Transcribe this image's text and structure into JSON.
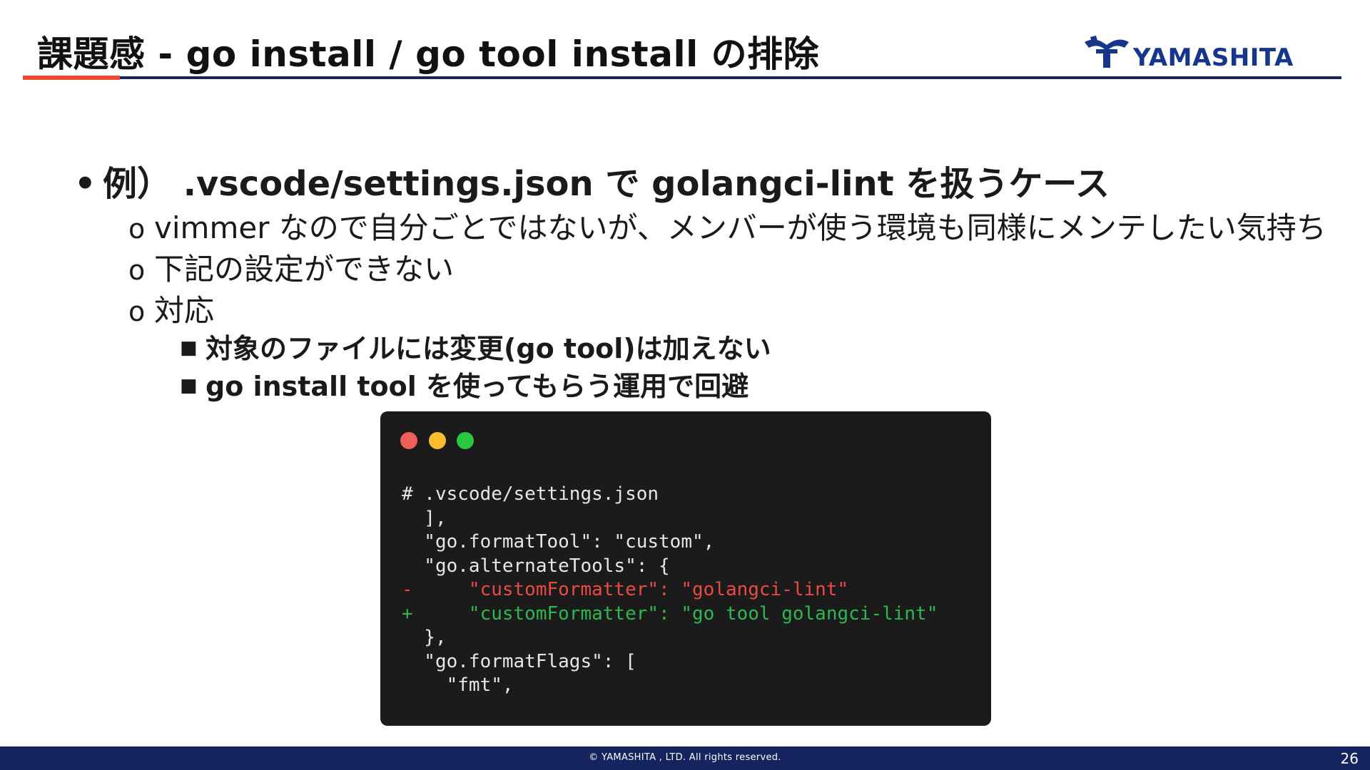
{
  "slide": {
    "title": "課題感 - go install / go tool install の排除",
    "logo_text": "YAMASHITA",
    "logo_icon": "yamashita-mark-icon",
    "colors": {
      "navy": "#15235e",
      "accent_red": "#ee4b30",
      "logo_blue": "#15368a"
    }
  },
  "bullets": {
    "l1": {
      "marker": "•",
      "text": "例） .vscode/settings.json で golangci-lint を扱うケース"
    },
    "l2": [
      {
        "marker": "o",
        "text": "vimmer なので自分ごとではないが、メンバーが使う環境も同様にメンテしたい気持ち"
      },
      {
        "marker": "o",
        "text": "下記の設定ができない"
      },
      {
        "marker": "o",
        "text": "対応"
      }
    ],
    "l3": [
      {
        "marker": "■",
        "text": "対象のファイルには変更(go tool)は加えない"
      },
      {
        "marker": "■",
        "text": "go install tool を使ってもらう運用で回避"
      }
    ]
  },
  "code": {
    "lines": [
      "# .vscode/settings.json",
      "  ],",
      "  \"go.formatTool\": \"custom\",",
      "  \"go.alternateTools\": {",
      "-     \"customFormatter\": \"golangci-lint\"",
      "+     \"customFormatter\": \"go tool golangci-lint\"",
      "  },",
      "  \"go.formatFlags\": [",
      "    \"fmt\","
    ]
  },
  "footer": {
    "copyright": "©  YAMASHITA , LTD.  All rights reserved.",
    "page_number": "26"
  }
}
